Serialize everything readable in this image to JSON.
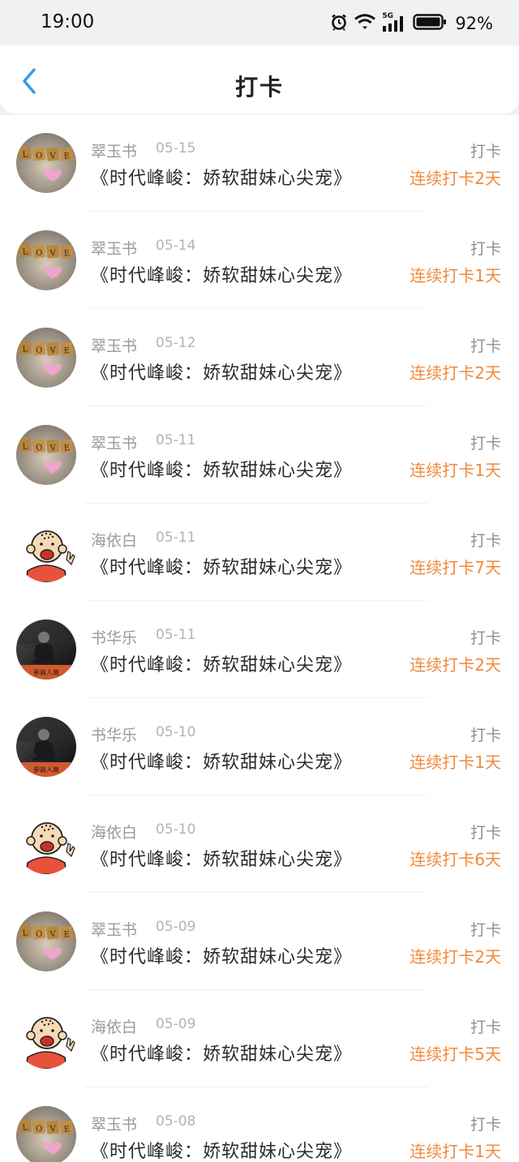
{
  "status_bar": {
    "time": "19:00",
    "network": "5G",
    "battery_percent": "92%",
    "icons": [
      "alarm-icon",
      "wifi-icon",
      "signal-5g-icon",
      "battery-icon"
    ]
  },
  "header": {
    "title": "打卡",
    "back_icon": "back-chevron-icon"
  },
  "colors": {
    "accent_blue": "#2f9bea",
    "streak_orange": "#f08a3c",
    "meta_gray": "#9a9a9a"
  },
  "checkins": [
    {
      "user": "翠玉书",
      "date": "05-15",
      "book": "《时代峰峻：娇软甜妹心尖宠》",
      "action": "打卡",
      "streak": "连续打卡2天",
      "avatar": "love-tiles"
    },
    {
      "user": "翠玉书",
      "date": "05-14",
      "book": "《时代峰峻：娇软甜妹心尖宠》",
      "action": "打卡",
      "streak": "连续打卡1天",
      "avatar": "love-tiles"
    },
    {
      "user": "翠玉书",
      "date": "05-12",
      "book": "《时代峰峻：娇软甜妹心尖宠》",
      "action": "打卡",
      "streak": "连续打卡2天",
      "avatar": "love-tiles"
    },
    {
      "user": "翠玉书",
      "date": "05-11",
      "book": "《时代峰峻：娇软甜妹心尖宠》",
      "action": "打卡",
      "streak": "连续打卡1天",
      "avatar": "love-tiles"
    },
    {
      "user": "海依白",
      "date": "05-11",
      "book": "《时代峰峻：娇软甜妹心尖宠》",
      "action": "打卡",
      "streak": "连续打卡7天",
      "avatar": "cartoon-monk"
    },
    {
      "user": "书华乐",
      "date": "05-11",
      "book": "《时代峰峻：娇软甜妹心尖宠》",
      "action": "打卡",
      "streak": "连续打卡2天",
      "avatar": "dark-photo"
    },
    {
      "user": "书华乐",
      "date": "05-10",
      "book": "《时代峰峻：娇软甜妹心尖宠》",
      "action": "打卡",
      "streak": "连续打卡1天",
      "avatar": "dark-photo"
    },
    {
      "user": "海依白",
      "date": "05-10",
      "book": "《时代峰峻：娇软甜妹心尖宠》",
      "action": "打卡",
      "streak": "连续打卡6天",
      "avatar": "cartoon-monk"
    },
    {
      "user": "翠玉书",
      "date": "05-09",
      "book": "《时代峰峻：娇软甜妹心尖宠》",
      "action": "打卡",
      "streak": "连续打卡2天",
      "avatar": "love-tiles"
    },
    {
      "user": "海依白",
      "date": "05-09",
      "book": "《时代峰峻：娇软甜妹心尖宠》",
      "action": "打卡",
      "streak": "连续打卡5天",
      "avatar": "cartoon-monk"
    },
    {
      "user": "翠玉书",
      "date": "05-08",
      "book": "《时代峰峻：娇软甜妹心尖宠》",
      "action": "打卡",
      "streak": "连续打卡1天",
      "avatar": "love-tiles"
    }
  ]
}
